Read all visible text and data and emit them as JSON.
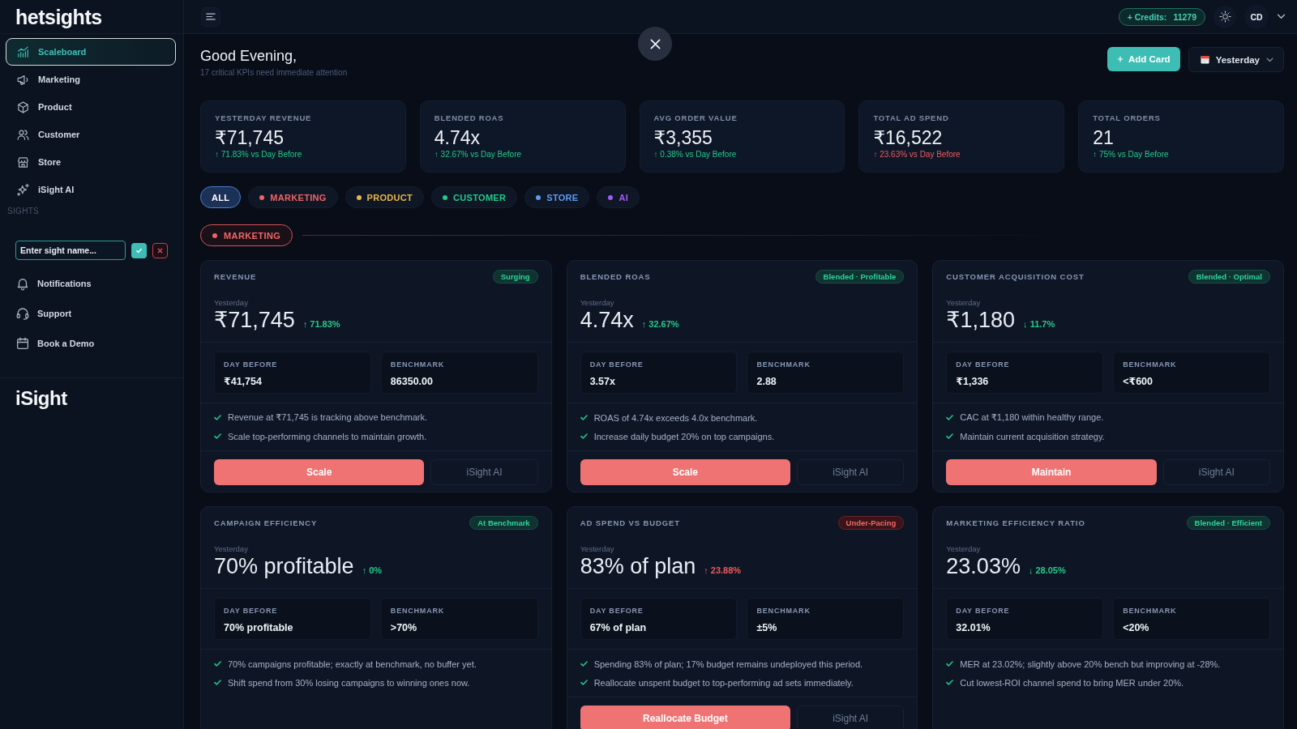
{
  "sidebar": {
    "logo": "hetsights",
    "nav": [
      {
        "label": "Scaleboard",
        "kind": "chart",
        "selected": true
      },
      {
        "label": "Marketing",
        "kind": "megaphone",
        "selected": false
      },
      {
        "label": "Product",
        "kind": "box",
        "selected": false
      },
      {
        "label": "Customer",
        "kind": "users",
        "selected": false
      },
      {
        "label": "Store",
        "kind": "store",
        "selected": false
      },
      {
        "label": "iSight AI",
        "kind": "sparkles",
        "selected": false
      }
    ],
    "section_label": "SIGHTS",
    "sight_input": {
      "placeholder": "Enter sight name..."
    },
    "footer_nav": [
      {
        "label": "Notifications",
        "kind": "bell",
        "selected": false
      },
      {
        "label": "Support",
        "kind": "headset",
        "selected": false
      },
      {
        "label": "Book a Demo",
        "kind": "calendar",
        "selected": false
      }
    ],
    "brand": "iSight"
  },
  "top_bar": {
    "credits": {
      "label": "+ Credits:",
      "value": "11279"
    },
    "user": {
      "initials": "CD"
    }
  },
  "header": {
    "greeting": "Good Evening,",
    "subtitle": "17 critical KPIs need immediate attention",
    "add_button": "Add Card",
    "date_range": "Yesterday"
  },
  "kpis": [
    {
      "label": "YESTERDAY REVENUE",
      "value": "₹71,745",
      "change": "↑ 71.83% vs Day Before",
      "negative": false
    },
    {
      "label": "BLENDED ROAS",
      "value": "4.74x",
      "change": "↑ 32.67% vs Day Before",
      "negative": false
    },
    {
      "label": "AVG ORDER VALUE",
      "value": "₹3,355",
      "change": "↑ 0.38% vs Day Before",
      "negative": false
    },
    {
      "label": "TOTAL AD SPEND",
      "value": "₹16,522",
      "change": "↑ 23.63% vs Day Before",
      "negative": true
    },
    {
      "label": "TOTAL ORDERS",
      "value": "21",
      "change": "↑ 75% vs Day Before",
      "negative": false
    }
  ],
  "filters": [
    {
      "label": "ALL",
      "selected": true
    },
    {
      "label": "MARKETING",
      "color": "#f06464",
      "selected": false
    },
    {
      "label": "PRODUCT",
      "color": "#e8b54a",
      "selected": false
    },
    {
      "label": "CUSTOMER",
      "color": "#22c98a",
      "selected": false
    },
    {
      "label": "STORE",
      "color": "#5b9cf0",
      "selected": false
    },
    {
      "label": "AI",
      "color": "#a35cf0",
      "selected": false
    }
  ],
  "section": {
    "label": "MARKETING"
  },
  "cards": [
    {
      "title": "REVENUE",
      "badge": {
        "label": "Surging",
        "negative": false
      },
      "period": "Yesterday",
      "value": "₹71,745",
      "change": {
        "text": "↑ 71.83%",
        "negative": false
      },
      "stats": [
        {
          "label": "DAY BEFORE",
          "value": "₹41,754"
        },
        {
          "label": "BENCHMARK",
          "value": "86350.00"
        }
      ],
      "insights": [
        "Revenue at ₹71,745 is tracking above benchmark.",
        "Scale top-performing channels to maintain growth."
      ],
      "actions": {
        "primary": "Scale",
        "secondary": "iSight AI"
      }
    },
    {
      "title": "BLENDED ROAS",
      "badge": {
        "label": "Blended · Profitable",
        "negative": false
      },
      "period": "Yesterday",
      "value": "4.74x",
      "change": {
        "text": "↑ 32.67%",
        "negative": false
      },
      "stats": [
        {
          "label": "DAY BEFORE",
          "value": "3.57x"
        },
        {
          "label": "BENCHMARK",
          "value": "2.88"
        }
      ],
      "insights": [
        "ROAS of 4.74x exceeds 4.0x benchmark.",
        "Increase daily budget 20% on top campaigns."
      ],
      "actions": {
        "primary": "Scale",
        "secondary": "iSight AI"
      }
    },
    {
      "title": "CUSTOMER ACQUISITION COST",
      "badge": {
        "label": "Blended · Optimal",
        "negative": false
      },
      "period": "Yesterday",
      "value": "₹1,180",
      "change": {
        "text": "↓ 11.7%",
        "negative": false
      },
      "stats": [
        {
          "label": "DAY BEFORE",
          "value": "₹1,336"
        },
        {
          "label": "BENCHMARK",
          "value": "<₹600"
        }
      ],
      "insights": [
        "CAC at ₹1,180 within healthy range.",
        "Maintain current acquisition strategy."
      ],
      "actions": {
        "primary": "Maintain",
        "secondary": "iSight AI"
      }
    },
    {
      "title": "CAMPAIGN EFFICIENCY",
      "badge": {
        "label": "At Benchmark",
        "negative": false
      },
      "period": "Yesterday",
      "value": "70% profitable",
      "change": {
        "text": "↑ 0%",
        "negative": false
      },
      "stats": [
        {
          "label": "DAY BEFORE",
          "value": "70% profitable"
        },
        {
          "label": "BENCHMARK",
          "value": ">70%"
        }
      ],
      "insights": [
        "70% campaigns profitable; exactly at benchmark, no buffer yet.",
        "Shift spend from 30% losing campaigns to winning ones now."
      ]
    },
    {
      "title": "AD SPEND VS BUDGET",
      "badge": {
        "label": "Under-Pacing",
        "negative": true
      },
      "period": "Yesterday",
      "value": "83% of plan",
      "change": {
        "text": "↑ 23.88%",
        "negative": true
      },
      "stats": [
        {
          "label": "DAY BEFORE",
          "value": "67% of plan"
        },
        {
          "label": "BENCHMARK",
          "value": "±5%"
        }
      ],
      "insights": [
        "Spending 83% of plan; 17% budget remains undeployed this period.",
        "Reallocate unspent budget to top-performing ad sets immediately."
      ],
      "actions": {
        "primary": "Reallocate Budget",
        "secondary": "iSight AI"
      }
    },
    {
      "title": "MARKETING EFFICIENCY RATIO",
      "badge": {
        "label": "Blended · Efficient",
        "negative": false
      },
      "period": "Yesterday",
      "value": "23.03%",
      "change": {
        "text": "↓ 28.05%",
        "negative": false
      },
      "stats": [
        {
          "label": "DAY BEFORE",
          "value": "32.01%"
        },
        {
          "label": "BENCHMARK",
          "value": "<20%"
        }
      ],
      "insights": [
        "MER at 23.02%; slightly above 20% bench but improving at -28%.",
        "Cut lowest-ROI channel spend to bring MER under 20%."
      ]
    }
  ]
}
